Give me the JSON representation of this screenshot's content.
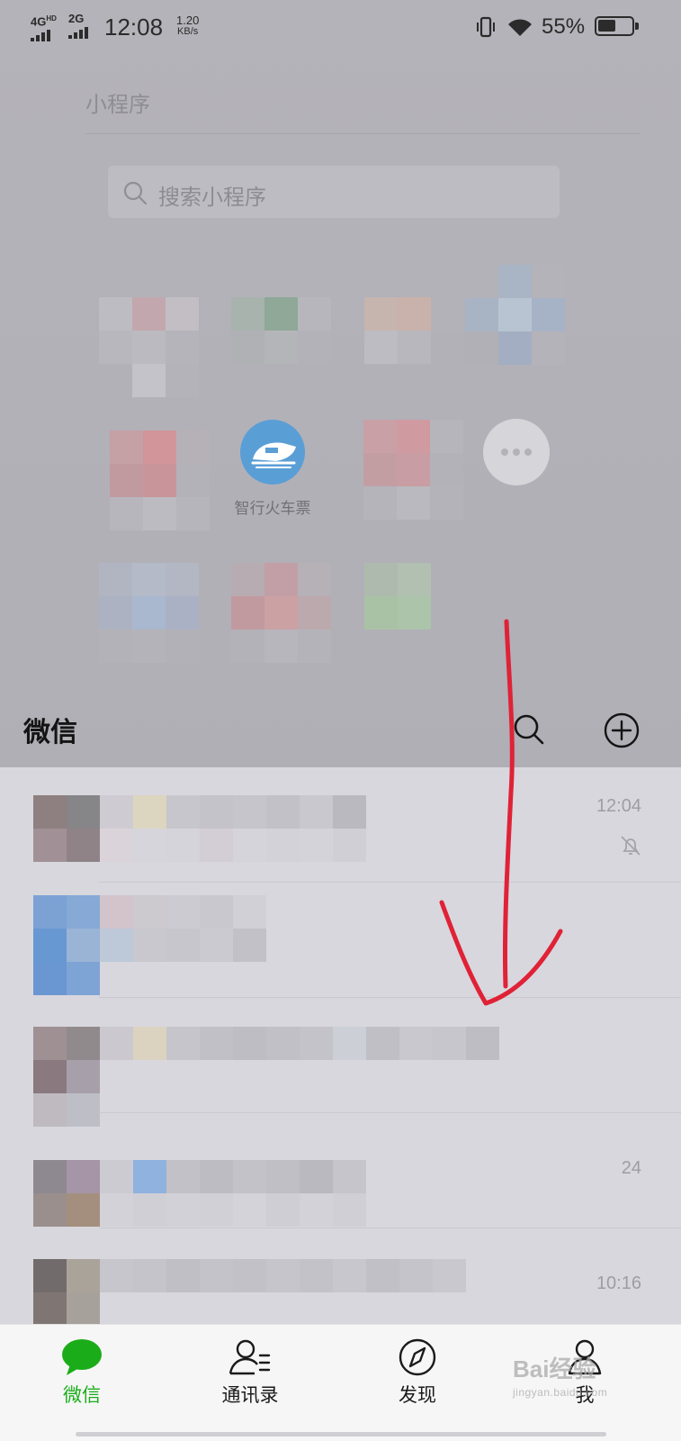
{
  "status_bar": {
    "network_1": "4G",
    "network_1_suffix": "HD",
    "network_2": "2G",
    "time": "12:08",
    "speed_value": "1.20",
    "speed_unit": "KB/s",
    "battery_percent": "55%",
    "battery_level": 0.55
  },
  "mini_programs": {
    "title": "小程序",
    "search_placeholder": "搜索小程序",
    "visible_app_label": "智行火车票"
  },
  "chat": {
    "title": "微信",
    "rows": [
      {
        "time": "12:04",
        "muted": true
      },
      {
        "time": ""
      },
      {
        "time": ""
      },
      {
        "time": "24"
      },
      {
        "time": "10:16"
      }
    ]
  },
  "tabs": [
    {
      "label": "微信",
      "icon": "chat-bubble-icon",
      "active": true
    },
    {
      "label": "通讯录",
      "icon": "contacts-icon",
      "active": false
    },
    {
      "label": "发现",
      "icon": "compass-icon",
      "active": false
    },
    {
      "label": "我",
      "icon": "profile-icon",
      "active": false
    }
  ],
  "watermark": {
    "brand": "Bai经验",
    "url": "jingyan.baidu.com"
  },
  "colors": {
    "accent_green": "#1aad19",
    "annotation_red": "#e02236",
    "train_icon_blue": "#5a9ed6"
  }
}
